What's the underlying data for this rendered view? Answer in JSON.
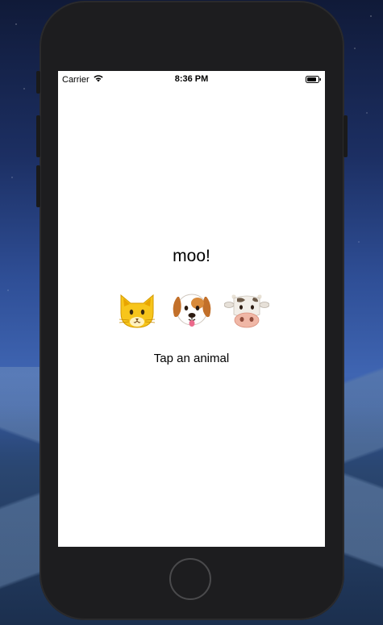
{
  "status_bar": {
    "carrier": "Carrier",
    "time": "8:36 PM",
    "wifi_icon": "wifi-icon",
    "battery_icon": "battery-icon"
  },
  "main": {
    "sound_label": "moo!",
    "animals": [
      {
        "name": "cat",
        "icon": "cat-face-icon"
      },
      {
        "name": "dog",
        "icon": "dog-face-icon"
      },
      {
        "name": "cow",
        "icon": "cow-face-icon"
      }
    ],
    "prompt": "Tap an animal"
  },
  "colors": {
    "screen_background": "#ffffff",
    "device_body": "#1d1d1f",
    "text": "#000000"
  }
}
